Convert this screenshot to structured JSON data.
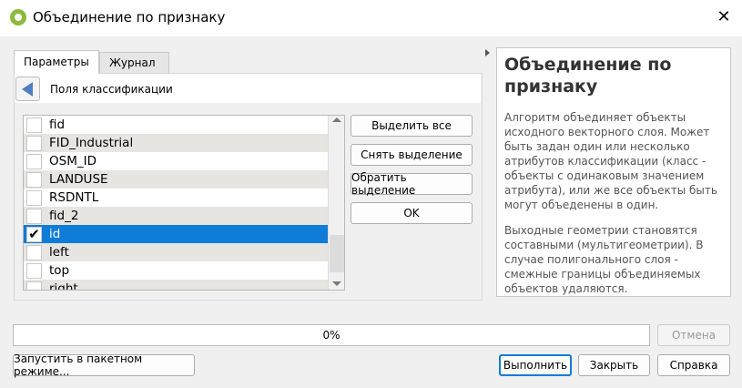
{
  "window": {
    "title": "Объединение по признаку"
  },
  "tabs": [
    {
      "label": "Параметры",
      "active": true
    },
    {
      "label": "Журнал",
      "active": false
    }
  ],
  "header": {
    "label": "Поля классификации"
  },
  "fields": [
    {
      "name": "fid",
      "checked": false
    },
    {
      "name": "FID_Industrial",
      "checked": false
    },
    {
      "name": "OSM_ID",
      "checked": false
    },
    {
      "name": "LANDUSE",
      "checked": false
    },
    {
      "name": "RSDNTL",
      "checked": false
    },
    {
      "name": "fid_2",
      "checked": false
    },
    {
      "name": "id",
      "checked": true,
      "selected": true
    },
    {
      "name": "left",
      "checked": false
    },
    {
      "name": "top",
      "checked": false
    },
    {
      "name": "right",
      "checked": false
    }
  ],
  "side_buttons": {
    "select_all": "Выделить все",
    "deselect": "Снять выделение",
    "invert": "Обратить выделение",
    "ok": "OK"
  },
  "help": {
    "title": "Объединение по признаку",
    "p1": "Алгоритм объединяет объекты исходного векторного слоя. Может быть задан один или несколько атрибутов классификации (класс - объекты с одинаковым значением атрибута), или же все объекты быть могут объеденены в один.",
    "p2": "Выходные геометрии становятся составными (мультигеометрии). В случае полигонального слоя - смежные границы объединяемых объектов удаляются."
  },
  "progress": {
    "text": "0%",
    "value": 0
  },
  "buttons": {
    "cancel": "Отмена",
    "batch": "Запустить в пакетном режиме...",
    "run": "Выполнить",
    "close": "Закрыть",
    "help": "Справка"
  }
}
